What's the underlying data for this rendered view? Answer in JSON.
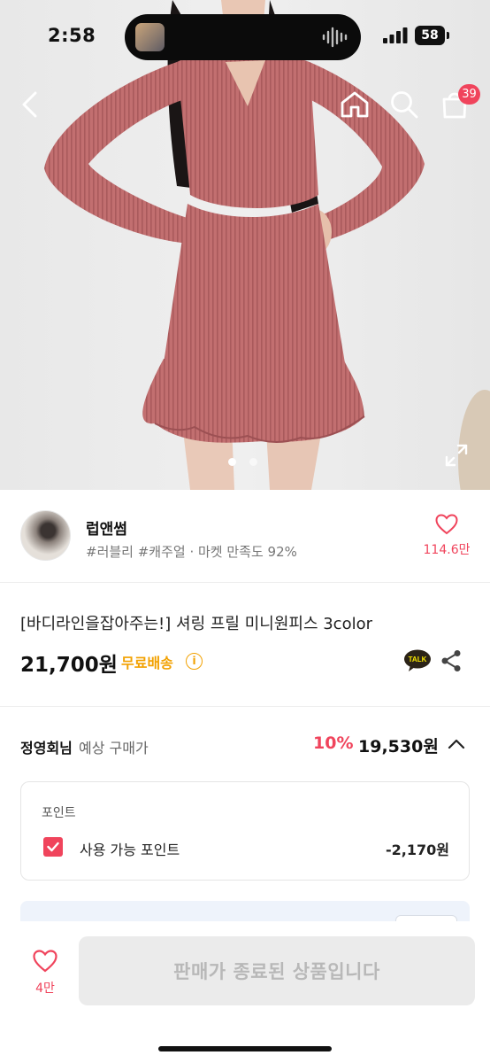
{
  "status_bar": {
    "time": "2:58",
    "battery": "58"
  },
  "header": {
    "cart_count": "39"
  },
  "gallery": {
    "total_images": 2,
    "active_index": 0
  },
  "seller": {
    "name": "럽앤썸",
    "tags": "#러블리 #캐주얼 · 마켓 만족도 92%",
    "likes": "114.6만"
  },
  "product": {
    "title": "[바디라인을잡아주는!] 셔링 프릴 미니원피스 3color",
    "price": "21,700원",
    "shipping": "무료배송",
    "info_symbol": "i"
  },
  "buyer_price": {
    "name": "정영회님",
    "label": "예상 구매가",
    "discount": "10%",
    "price": "19,530원"
  },
  "points": {
    "title": "포인트",
    "label": "사용 가능 포인트",
    "value": "-2,170원",
    "checked": true
  },
  "bottom_bar": {
    "wish_count": "4만",
    "cta_label": "판매가 종료된 상품입니다"
  },
  "colors": {
    "accent": "#f0445c",
    "shipping": "#f2a100",
    "disabled_bg": "#ebebeb",
    "disabled_text": "#b8b8b8"
  },
  "icons": [
    "back-arrow-icon",
    "home-icon",
    "search-icon",
    "cart-icon",
    "expand-icon",
    "heart-icon",
    "info-icon",
    "kakao-talk-icon",
    "share-icon",
    "chevron-up-icon",
    "checkbox-checked-icon"
  ]
}
